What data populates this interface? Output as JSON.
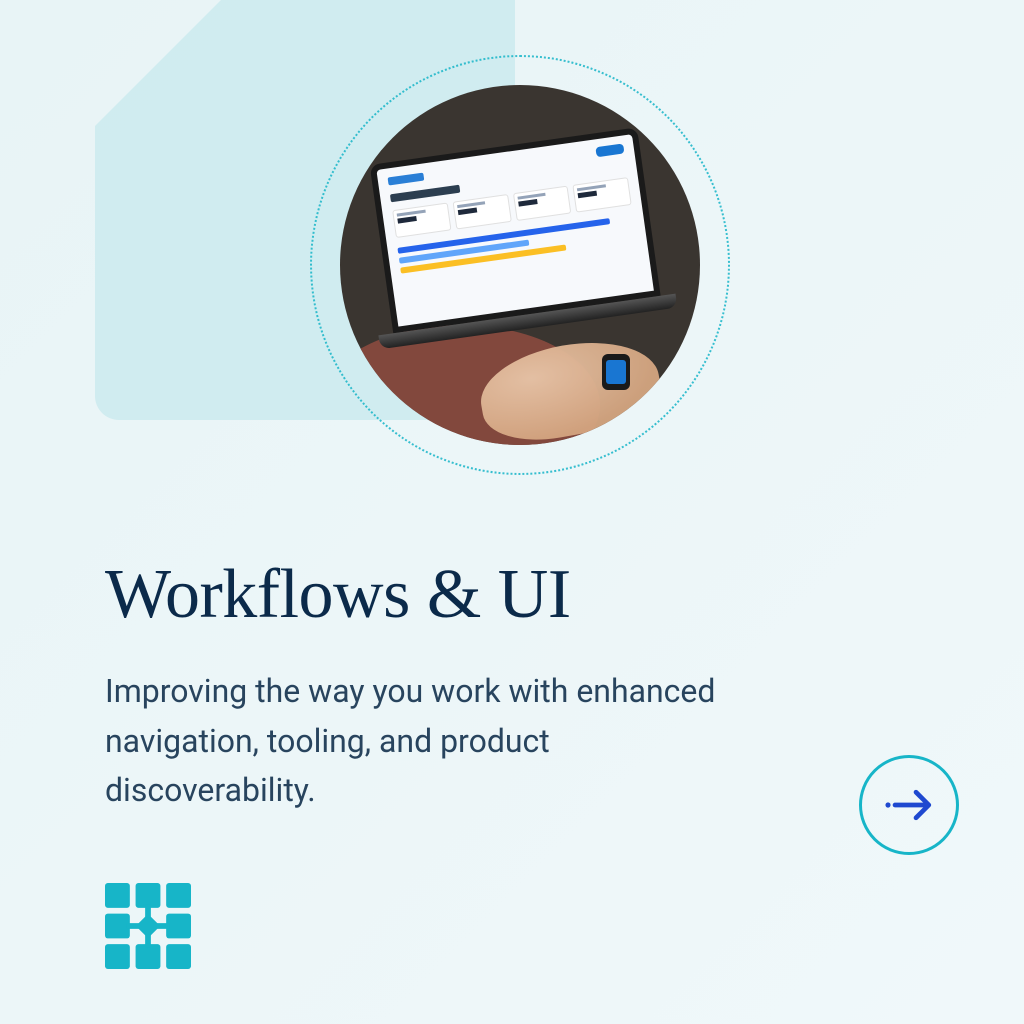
{
  "heading": "Workflows & UI",
  "description": "Improving the way you work with enhanced navigation, tooling, and product discoverability.",
  "colors": {
    "accent_teal": "#17b5c8",
    "brand_dark": "#0b2a4a",
    "arrow_blue": "#1f49d0"
  },
  "icons": {
    "next": "arrow-right-icon",
    "brand": "grid-logo-icon"
  }
}
